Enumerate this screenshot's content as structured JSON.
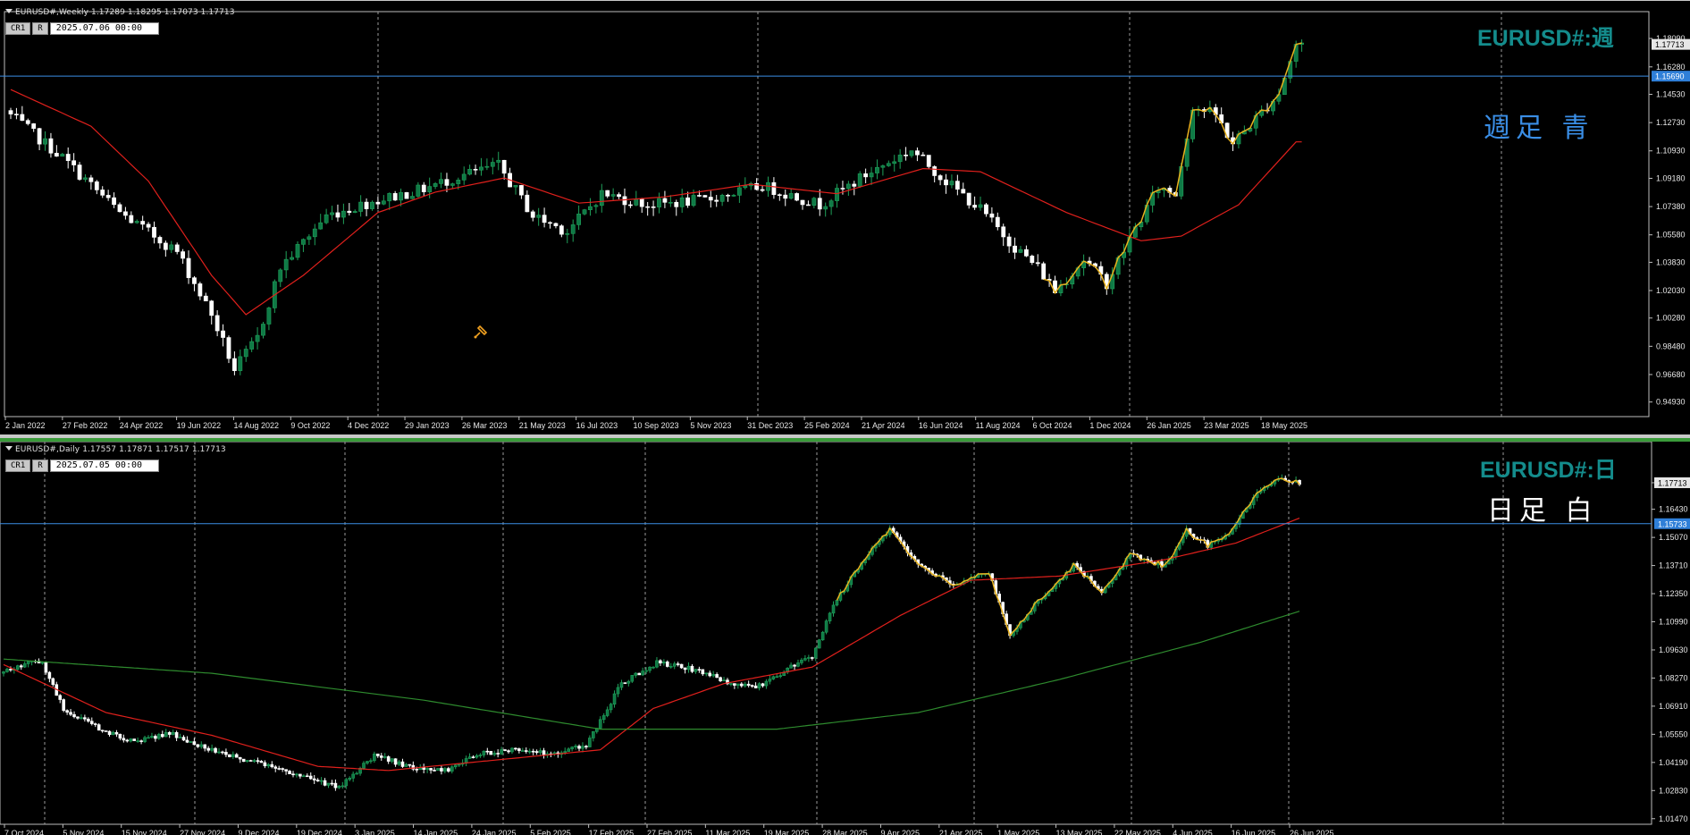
{
  "weekly": {
    "header": "EURUSD#,Weekly  1.17289 1.18295 1.17073 1.17713",
    "buttons": [
      "CR1",
      "R"
    ],
    "date": "2025.07.06 00:00",
    "symbol_label": "EURUSD#:週",
    "note": "週足 青",
    "current_price": "1.17713",
    "hline_price": "1.15690",
    "hline_value": 1.1569,
    "price_range": [
      0.94,
      1.198
    ],
    "y_ticks": [
      "1.18090",
      "1.16280",
      "1.14530",
      "1.12730",
      "1.10930",
      "1.09180",
      "1.07380",
      "1.05580",
      "1.03830",
      "1.02030",
      "1.00280",
      "0.98480",
      "0.96680",
      "0.94930"
    ],
    "x_ticks": [
      "2 Jan 2022",
      "27 Feb 2022",
      "24 Apr 2022",
      "19 Jun 2022",
      "14 Aug 2022",
      "9 Oct 2022",
      "4 Dec 2022",
      "29 Jan 2023",
      "26 Mar 2023",
      "21 May 2023",
      "16 Jul 2023",
      "10 Sep 2023",
      "5 Nov 2023",
      "31 Dec 2023",
      "25 Feb 2024",
      "21 Apr 2024",
      "16 Jun 2024",
      "11 Aug 2024",
      "6 Oct 2024",
      "1 Dec 2024",
      "26 Jan 2025",
      "23 Mar 2025",
      "18 May 2025"
    ],
    "anchors": [
      [
        0,
        1.135
      ],
      [
        10,
        1.105
      ],
      [
        20,
        1.07
      ],
      [
        30,
        1.045
      ],
      [
        36,
        1.005
      ],
      [
        40,
        0.97
      ],
      [
        44,
        0.99
      ],
      [
        48,
        1.035
      ],
      [
        56,
        1.068
      ],
      [
        64,
        1.077
      ],
      [
        72,
        1.084
      ],
      [
        80,
        1.094
      ],
      [
        86,
        1.1
      ],
      [
        92,
        1.068
      ],
      [
        98,
        1.058
      ],
      [
        104,
        1.082
      ],
      [
        112,
        1.075
      ],
      [
        122,
        1.078
      ],
      [
        132,
        1.087
      ],
      [
        142,
        1.075
      ],
      [
        150,
        1.094
      ],
      [
        158,
        1.11
      ],
      [
        164,
        1.09
      ],
      [
        170,
        1.072
      ],
      [
        176,
        1.048
      ],
      [
        180,
        1.035
      ],
      [
        183,
        1.02
      ],
      [
        188,
        1.04
      ],
      [
        192,
        1.025
      ],
      [
        197,
        1.06
      ],
      [
        201,
        1.086
      ],
      [
        204,
        1.082
      ],
      [
        207,
        1.138
      ],
      [
        211,
        1.132
      ],
      [
        214,
        1.114
      ],
      [
        218,
        1.13
      ],
      [
        222,
        1.146
      ],
      [
        225,
        1.177
      ]
    ],
    "ma_anchors": [
      [
        0,
        1.15
      ],
      [
        15,
        1.125
      ],
      [
        25,
        1.09
      ],
      [
        36,
        1.03
      ],
      [
        42,
        1.005
      ],
      [
        52,
        1.03
      ],
      [
        65,
        1.07
      ],
      [
        75,
        1.083
      ],
      [
        87,
        1.092
      ],
      [
        100,
        1.076
      ],
      [
        115,
        1.08
      ],
      [
        130,
        1.088
      ],
      [
        145,
        1.082
      ],
      [
        160,
        1.098
      ],
      [
        170,
        1.096
      ],
      [
        185,
        1.07
      ],
      [
        198,
        1.052
      ],
      [
        205,
        1.055
      ],
      [
        215,
        1.075
      ],
      [
        225,
        1.115
      ]
    ]
  },
  "daily": {
    "header": "EURUSD#,Daily  1.17557 1.17871 1.17517 1.17713",
    "buttons": [
      "CR1",
      "R"
    ],
    "date": "2025.07.05 00:00",
    "symbol_label": "EURUSD#:日",
    "note": "日足 白",
    "current_price": "1.17713",
    "hline_price": "1.15733",
    "hline_value": 1.15733,
    "price_range": [
      1.012,
      1.197
    ],
    "y_ticks": [
      "1.17713",
      "1.16430",
      "1.15070",
      "1.13710",
      "1.12350",
      "1.10990",
      "1.09630",
      "1.08270",
      "1.06910",
      "1.05550",
      "1.04190",
      "1.02830",
      "1.01470"
    ],
    "x_ticks": [
      "7 Oct 2024",
      "5 Nov 2024",
      "15 Nov 2024",
      "27 Nov 2024",
      "9 Dec 2024",
      "19 Dec 2024",
      "3 Jan 2025",
      "14 Jan 2025",
      "24 Jan 2025",
      "5 Feb 2025",
      "17 Feb 2025",
      "27 Feb 2025",
      "11 Mar 2025",
      "19 Mar 2025",
      "28 Mar 2025",
      "9 Apr 2025",
      "21 Apr 2025",
      "1 May 2025",
      "13 May 2025",
      "22 May 2025",
      "4 Jun 2025",
      "16 Jun 2025",
      "26 Jun 2025"
    ],
    "anchors": [
      [
        0,
        1.085
      ],
      [
        8,
        1.09
      ],
      [
        12,
        1.09
      ],
      [
        18,
        1.068
      ],
      [
        28,
        1.058
      ],
      [
        38,
        1.052
      ],
      [
        48,
        1.056
      ],
      [
        60,
        1.048
      ],
      [
        70,
        1.043
      ],
      [
        80,
        1.038
      ],
      [
        90,
        1.033
      ],
      [
        96,
        1.03
      ],
      [
        106,
        1.045
      ],
      [
        116,
        1.04
      ],
      [
        126,
        1.038
      ],
      [
        136,
        1.046
      ],
      [
        146,
        1.048
      ],
      [
        156,
        1.046
      ],
      [
        166,
        1.05
      ],
      [
        176,
        1.08
      ],
      [
        186,
        1.09
      ],
      [
        196,
        1.087
      ],
      [
        206,
        1.081
      ],
      [
        214,
        1.078
      ],
      [
        224,
        1.088
      ],
      [
        230,
        1.093
      ],
      [
        236,
        1.118
      ],
      [
        244,
        1.138
      ],
      [
        252,
        1.155
      ],
      [
        260,
        1.138
      ],
      [
        270,
        1.128
      ],
      [
        280,
        1.134
      ],
      [
        286,
        1.103
      ],
      [
        294,
        1.12
      ],
      [
        304,
        1.137
      ],
      [
        312,
        1.125
      ],
      [
        320,
        1.142
      ],
      [
        330,
        1.137
      ],
      [
        336,
        1.154
      ],
      [
        342,
        1.147
      ],
      [
        348,
        1.152
      ],
      [
        356,
        1.172
      ],
      [
        362,
        1.18
      ],
      [
        368,
        1.177
      ]
    ],
    "ma_red_anchors": [
      [
        0,
        1.09
      ],
      [
        30,
        1.066
      ],
      [
        60,
        1.055
      ],
      [
        90,
        1.04
      ],
      [
        110,
        1.038
      ],
      [
        140,
        1.043
      ],
      [
        170,
        1.048
      ],
      [
        185,
        1.068
      ],
      [
        205,
        1.08
      ],
      [
        230,
        1.088
      ],
      [
        255,
        1.113
      ],
      [
        275,
        1.13
      ],
      [
        300,
        1.132
      ],
      [
        330,
        1.14
      ],
      [
        350,
        1.148
      ],
      [
        368,
        1.16
      ]
    ],
    "ma_green_anchors": [
      [
        0,
        1.092
      ],
      [
        60,
        1.085
      ],
      [
        120,
        1.072
      ],
      [
        170,
        1.058
      ],
      [
        220,
        1.058
      ],
      [
        260,
        1.066
      ],
      [
        300,
        1.082
      ],
      [
        340,
        1.1
      ],
      [
        368,
        1.115
      ]
    ]
  }
}
